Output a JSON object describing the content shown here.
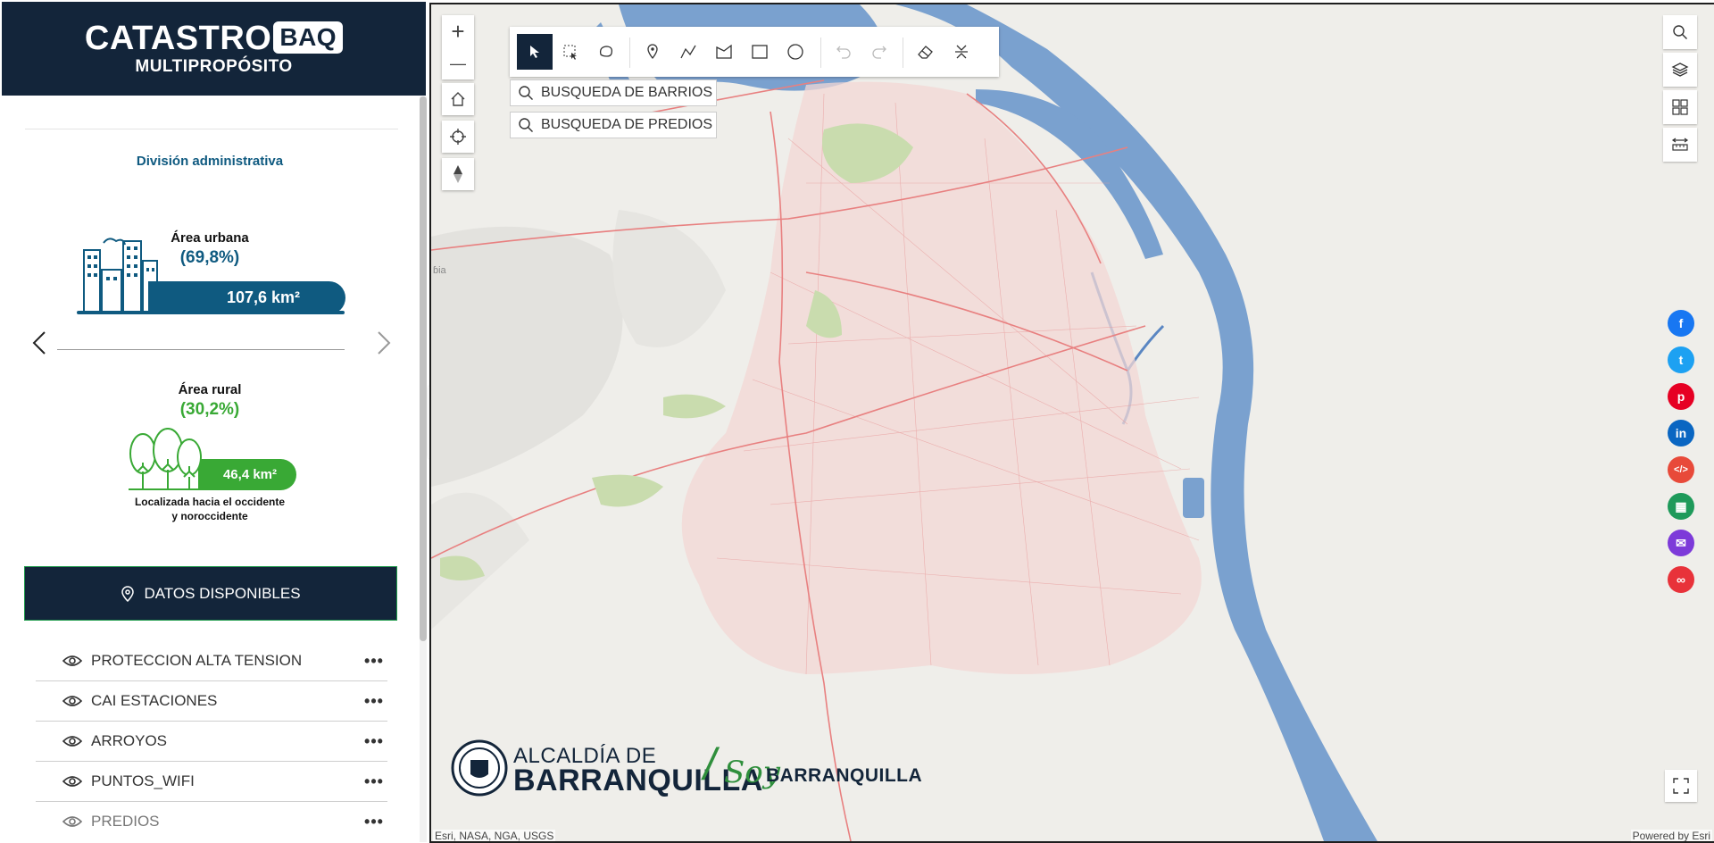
{
  "brand": {
    "title": "CATASTRO",
    "title_badge": "BAQ",
    "subtitle": "MULTIPROPÓSITO"
  },
  "admin": {
    "heading": "División administrativa",
    "urban": {
      "label": "Área urbana",
      "percent": "(69,8%)",
      "area": "107,6 km²"
    },
    "rural": {
      "label": "Área rural",
      "percent": "(30,2%)",
      "area": "46,4 km²",
      "note_line1": "Localizada hacia el occidente",
      "note_line2": "y noroccidente"
    }
  },
  "datos": {
    "button_label": "DATOS DISPONIBLES",
    "layers": [
      {
        "name": "PROTECCION ALTA TENSION",
        "menu": "•••"
      },
      {
        "name": "CAI ESTACIONES",
        "menu": "•••"
      },
      {
        "name": "ARROYOS",
        "menu": "•••"
      },
      {
        "name": "PUNTOS_WIFI",
        "menu": "•••"
      },
      {
        "name": "PREDIOS",
        "menu": "•••"
      }
    ]
  },
  "map": {
    "search_barrios": "BUSQUEDA DE BARRIOS",
    "search_predios": "BUSQUEDA DE PREDIOS",
    "zoom_in": "+",
    "zoom_out": "—",
    "attribution_left": "Esri, NASA, NGA, USGS",
    "attribution_right": "Powered by Esri",
    "edge_label": "ɓia",
    "logo_line1": "ALCALDÍA DE",
    "logo_line2": "BARRANQUILLA",
    "logo_slash": "/",
    "logo_soy": "Soy",
    "logo_baq": "BARRANQUILLA"
  },
  "share_buttons": [
    {
      "icon": "facebook-icon",
      "glyph": "f",
      "color": "#1877f2"
    },
    {
      "icon": "twitter-icon",
      "glyph": "t",
      "color": "#1da1f2"
    },
    {
      "icon": "pinterest-icon",
      "glyph": "p",
      "color": "#e60023"
    },
    {
      "icon": "linkedin-icon",
      "glyph": "in",
      "color": "#0a66c2"
    },
    {
      "icon": "embed-icon",
      "glyph": "</>",
      "color": "#e84a3a"
    },
    {
      "icon": "qr-code-icon",
      "glyph": "▦",
      "color": "#1e9a5a"
    },
    {
      "icon": "email-icon",
      "glyph": "✉",
      "color": "#7d3ad9"
    },
    {
      "icon": "link-icon",
      "glyph": "∞",
      "color": "#e8323a"
    }
  ],
  "colors": {
    "navy": "#13253a",
    "urban_blue": "#0f5a80",
    "rural_green": "#39a935",
    "water": "#7aa1cf",
    "roads": "#e8a0a0"
  }
}
